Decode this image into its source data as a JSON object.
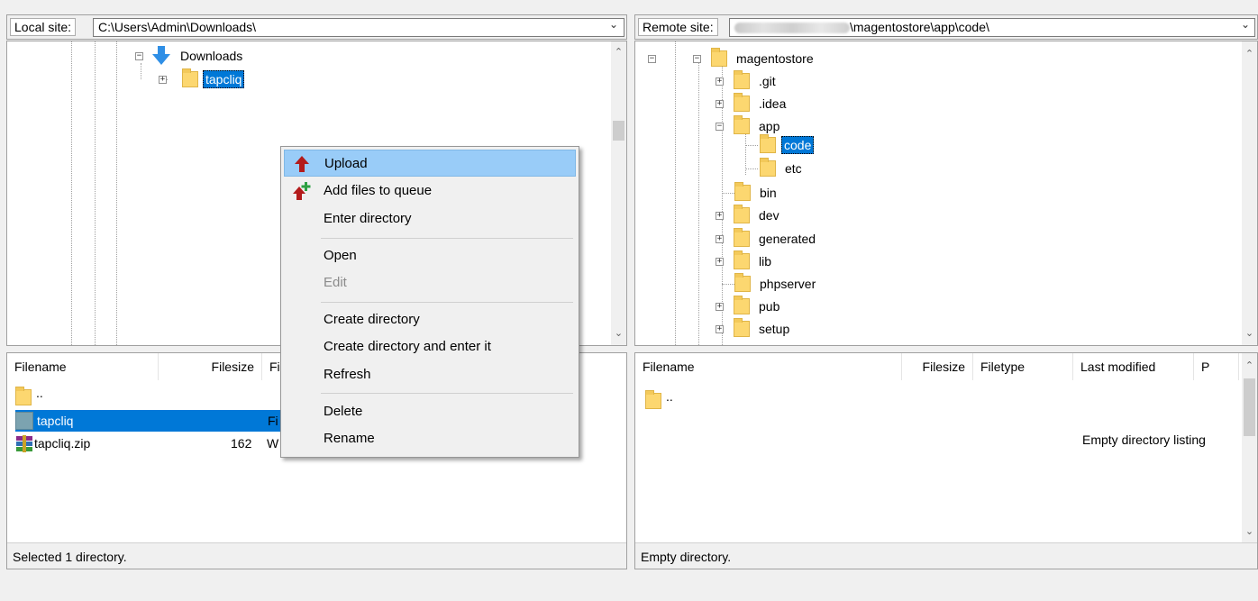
{
  "local": {
    "site_label": "Local site:",
    "site_path": "C:\\Users\\Admin\\Downloads\\",
    "tree": {
      "downloads": "Downloads",
      "tapcliq": "tapcliq"
    },
    "columns": {
      "filename": "Filename",
      "filesize": "Filesize",
      "filetype": "Fi"
    },
    "files": [
      {
        "name": "..",
        "size": "",
        "type": ""
      },
      {
        "name": "tapcliq",
        "size": "",
        "type": "Fi"
      },
      {
        "name": "tapcliq.zip",
        "size": "162",
        "type": "W"
      }
    ],
    "status": "Selected 1 directory."
  },
  "remote": {
    "site_label": "Remote site:",
    "site_path_suffix": "\\magentostore\\app\\code\\",
    "tree": {
      "root": "magentostore",
      "git": ".git",
      "idea": ".idea",
      "app": "app",
      "code": "code",
      "etc": "etc",
      "bin": "bin",
      "dev": "dev",
      "generated": "generated",
      "lib": "lib",
      "phpserver": "phpserver",
      "pub": "pub",
      "setup": "setup"
    },
    "columns": {
      "filename": "Filename",
      "filesize": "Filesize",
      "filetype": "Filetype",
      "last_modified": "Last modified",
      "permissions": "P"
    },
    "files": [
      {
        "name": ".."
      }
    ],
    "empty_text": "Empty directory listing",
    "status": "Empty directory."
  },
  "context_menu": {
    "upload": "Upload",
    "add_to_queue": "Add files to queue",
    "enter_directory": "Enter directory",
    "open": "Open",
    "edit": "Edit",
    "create_directory": "Create directory",
    "create_and_enter": "Create directory and enter it",
    "refresh": "Refresh",
    "delete": "Delete",
    "rename": "Rename"
  },
  "colors": {
    "selection": "#0078d7",
    "menu_highlight": "#99ccf8",
    "folder": "#fcd770",
    "upload_arrow": "#b31b1b",
    "queue_plus": "#2ea043"
  }
}
